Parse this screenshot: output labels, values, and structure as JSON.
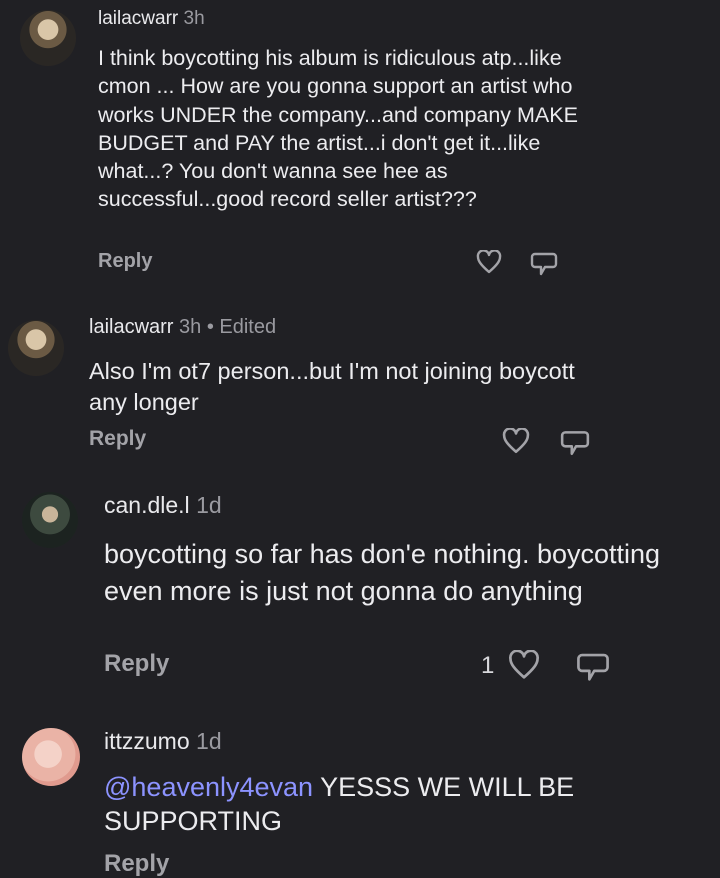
{
  "comments": [
    {
      "username": "lailacwarr",
      "time": "3h",
      "edited": "",
      "text": "I think boycotting his album is ridiculous atp...like cmon ... How are you gonna support an artist who works UNDER the company...and company MAKE BUDGET and PAY the artist...i don't get it...like what...? You don't wanna see hee as successful...good record seller artist???",
      "reply": "Reply",
      "likes": "",
      "avatar_icon": "profile-photo"
    },
    {
      "username": "lailacwarr",
      "time": "3h",
      "edited": "• Edited",
      "text": "Also I'm ot7 person...but I'm not joining boycott any longer",
      "reply": "Reply",
      "likes": "",
      "avatar_icon": "profile-photo"
    },
    {
      "username": "can.dle.l",
      "time": "1d",
      "edited": "",
      "text": "boycotting so far has don'e nothing. boycotting even more is just not gonna do anything",
      "reply": "Reply",
      "likes": "1",
      "avatar_icon": "profile-photo"
    },
    {
      "username": "ittzzumo",
      "time": "1d",
      "edited": "",
      "mention": "@heavenly4evan",
      "text": " YESSS WE WILL BE SUPPORTING",
      "reply": "Reply",
      "likes": "",
      "avatar_icon": "profile-photo"
    }
  ],
  "colors": {
    "background": "#202024",
    "mention": "#8c93ff",
    "muted": "#9a9aa0"
  }
}
